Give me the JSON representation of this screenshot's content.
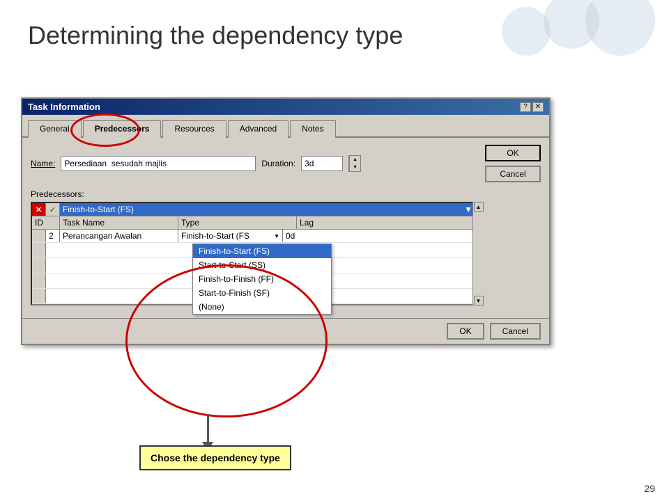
{
  "page": {
    "title": "Determining the dependency type",
    "number": "29"
  },
  "dialog": {
    "title": "Task Information",
    "tabs": [
      {
        "label": "General",
        "id": "general",
        "active": false
      },
      {
        "label": "Predecessors",
        "id": "predecessors",
        "active": true
      },
      {
        "label": "Resources",
        "id": "resources",
        "active": false
      },
      {
        "label": "Advanced",
        "id": "advanced",
        "active": false
      },
      {
        "label": "Notes",
        "id": "notes",
        "active": false
      }
    ],
    "name_label": "Name:",
    "name_value": "Persediaan  sesudah majlis",
    "duration_label": "Duration:",
    "duration_value": "3d",
    "ok_label": "OK",
    "cancel_label": "Cancel",
    "predecessors_label": "Predecessors:",
    "grid": {
      "columns": [
        "ID",
        "Task Name",
        "Type",
        "Lag"
      ],
      "combo_value": "Finish-to-Start (FS)",
      "rows": [
        {
          "id": "2",
          "task_name": "Perancangan Awalan",
          "type": "Finish-to-Start (FS",
          "lag": "0d"
        }
      ],
      "dropdown_options": [
        {
          "label": "Finish-to-Start (FS)",
          "selected": true
        },
        {
          "label": "Start-to-Start (SS)",
          "selected": false
        },
        {
          "label": "Finish-to-Finish (FF)",
          "selected": false
        },
        {
          "label": "Start-to-Finish (SF)",
          "selected": false
        },
        {
          "label": "(None)",
          "selected": false
        }
      ]
    }
  },
  "callout": {
    "text": "Chose the dependency type"
  },
  "icons": {
    "x_mark": "✕",
    "check_mark": "✓",
    "up_arrow": "▲",
    "down_arrow": "▼",
    "dropdown_arrow": "▼",
    "scroll_up": "▲",
    "scroll_down": "▼",
    "help": "?",
    "close": "✕"
  }
}
